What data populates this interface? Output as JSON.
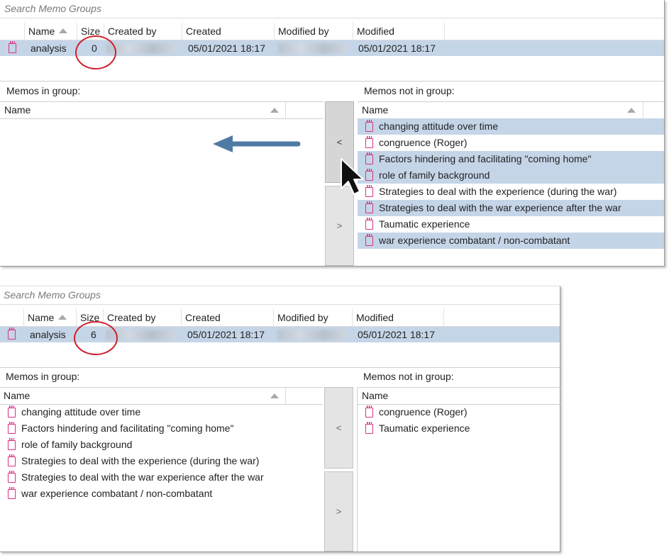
{
  "before": {
    "search_placeholder": "Search Memo Groups",
    "columns": [
      "Name",
      "Size",
      "Created by",
      "Created",
      "Modified by",
      "Modified"
    ],
    "group": {
      "name": "analysis",
      "size": "0",
      "created": "05/01/2021 18:17",
      "modified": "05/01/2021 18:17"
    },
    "in_group_label": "Memos in group:",
    "not_in_group_label": "Memos not in group:",
    "list_header": "Name",
    "move_left": "<",
    "move_right": ">",
    "in_group_items": [],
    "not_in_group_items": [
      "changing attitude over time",
      "congruence (Roger)",
      "Factors hindering and facilitating \"coming home\"",
      "role of family background",
      "Strategies to deal with the experience (during the war)",
      "Strategies to deal with the war experience after the war",
      "Taumatic experience",
      "war experience combatant / non-combatant"
    ],
    "not_in_group_selected": [
      true,
      false,
      true,
      true,
      false,
      true,
      false,
      true
    ]
  },
  "after": {
    "search_placeholder": "Search Memo Groups",
    "columns": [
      "Name",
      "Size",
      "Created by",
      "Created",
      "Modified by",
      "Modified"
    ],
    "group": {
      "name": "analysis",
      "size": "6",
      "created": "05/01/2021 18:17",
      "modified": "05/01/2021 18:17"
    },
    "in_group_label": "Memos in group:",
    "not_in_group_label": "Memos not in group:",
    "list_header": "Name",
    "move_left": "<",
    "move_right": ">",
    "in_group_items": [
      "changing attitude over time",
      "Factors hindering and facilitating \"coming home\"",
      "role of family background",
      "Strategies to deal with the experience (during the war)",
      "Strategies to deal with the war experience after the war",
      "war experience combatant / non-combatant"
    ],
    "not_in_group_items": [
      "congruence (Roger)",
      "Taumatic experience"
    ]
  },
  "colors": {
    "selection": "#c5d5e8",
    "memo_icon": "#d63384",
    "annotation_circle": "#d0202a",
    "arrow": "#4f7aa3"
  },
  "icons": {
    "memo": "memo-icon",
    "sort": "sort-ascending-icon",
    "cursor": "mouse-pointer-icon"
  }
}
